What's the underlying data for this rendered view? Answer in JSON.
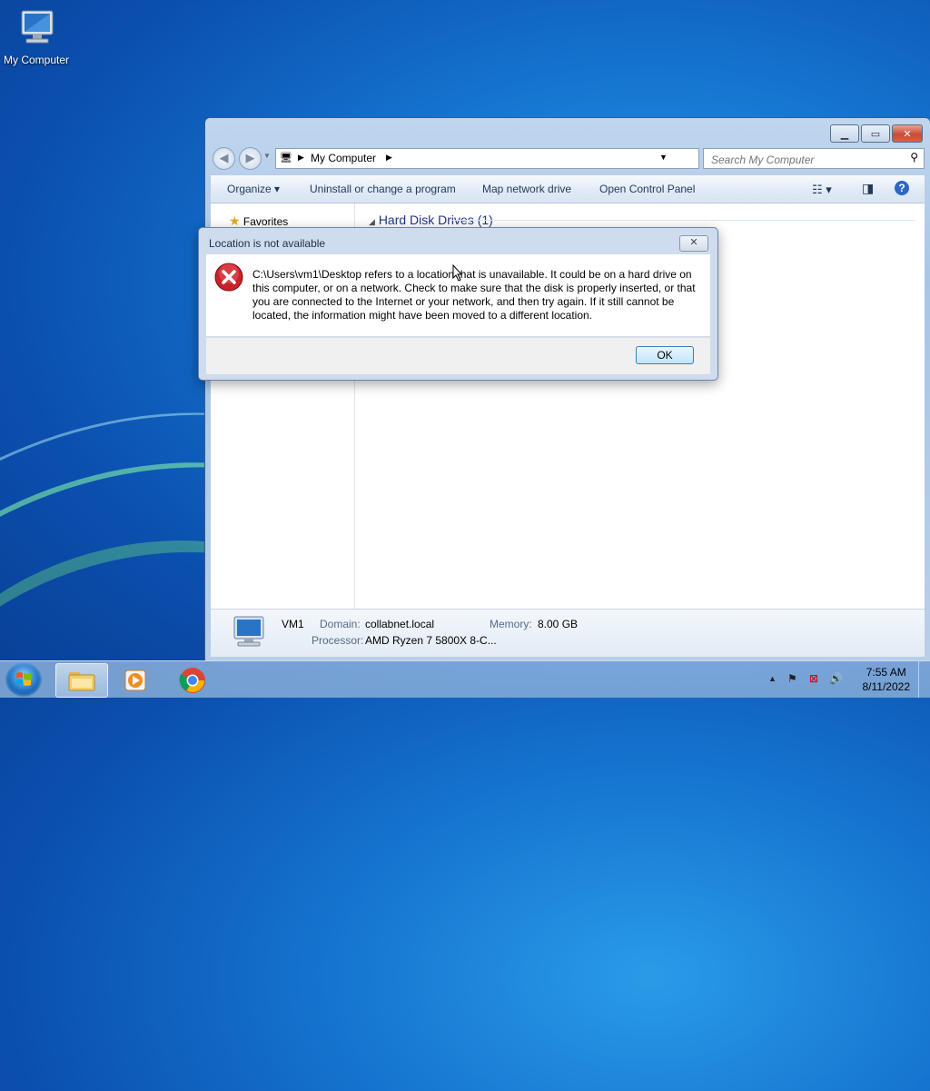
{
  "desktop": {
    "icon_label": "My Computer"
  },
  "window": {
    "address_text": "My Computer",
    "search_placeholder": "Search My Computer",
    "toolbar": {
      "organize": "Organize",
      "uninstall": "Uninstall or change a program",
      "map_drive": "Map network drive",
      "control_panel": "Open Control Panel"
    },
    "nav": {
      "favorites": "Favorites"
    },
    "section_title": "Hard Disk Drives (1)",
    "details": {
      "name": "VM1",
      "domain_label": "Domain:",
      "domain_value": "collabnet.local",
      "memory_label": "Memory:",
      "memory_value": "8.00 GB",
      "processor_label": "Processor:",
      "processor_value": "AMD Ryzen 7 5800X 8-C..."
    }
  },
  "dialog": {
    "title": "Location is not available",
    "message": "C:\\Users\\vm1\\Desktop refers to a location that is unavailable. It could be on a hard drive on this computer, or on a network. Check to make sure that the disk is properly inserted, or that you are connected to the Internet or your network, and then try again. If it still cannot be located, the information might have been moved to a different location.",
    "ok_label": "OK"
  },
  "taskbar": {
    "time": "7:55 AM",
    "date": "8/11/2022"
  }
}
